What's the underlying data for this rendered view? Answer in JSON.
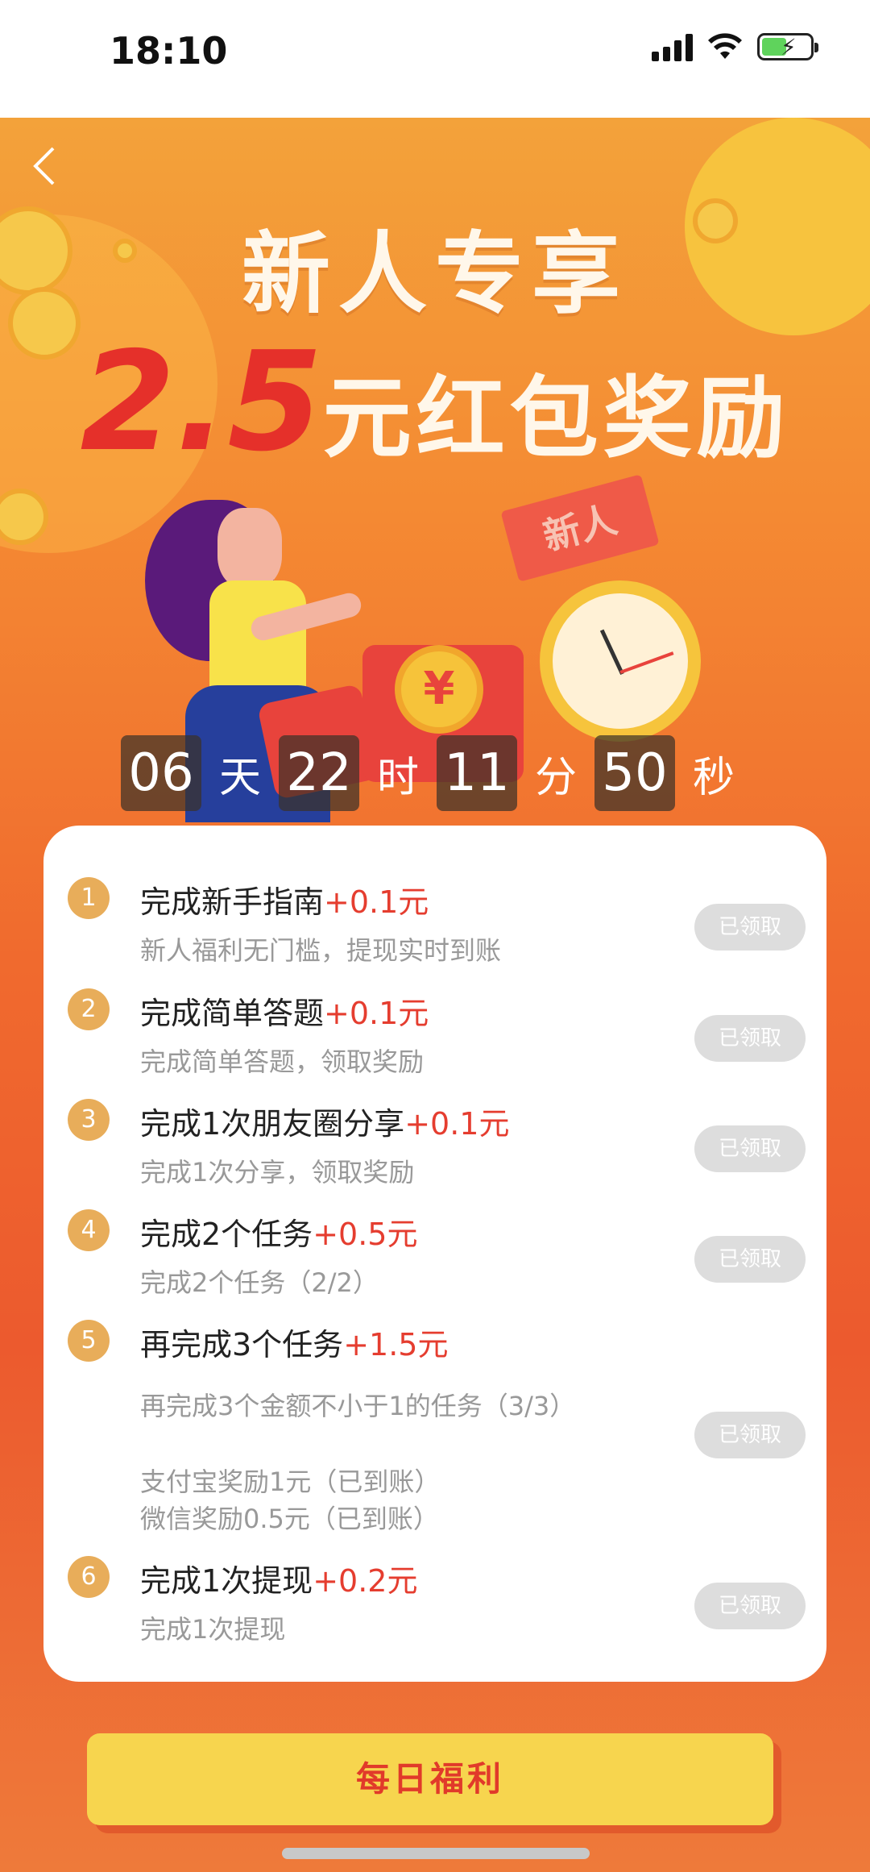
{
  "status_bar": {
    "time": "18:10"
  },
  "hero": {
    "title_line1": "新人专享",
    "amount": "2.5",
    "title_line2_rest": "元红包奖励",
    "ticket_text": "新人",
    "coin_symbol": "¥"
  },
  "countdown": {
    "days": "06",
    "days_unit": "天",
    "hours": "22",
    "hours_unit": "时",
    "minutes": "11",
    "minutes_unit": "分",
    "seconds": "50",
    "seconds_unit": "秒"
  },
  "tasks": [
    {
      "num": "1",
      "title": "完成新手指南",
      "reward": "+0.1元",
      "desc": "新人福利无门槛，提现实时到账",
      "button": "已领取"
    },
    {
      "num": "2",
      "title": "完成简单答题",
      "reward": "+0.1元",
      "desc": "完成简单答题，领取奖励",
      "button": "已领取"
    },
    {
      "num": "3",
      "title": "完成1次朋友圈分享",
      "reward": "+0.1元",
      "desc": "完成1次分享，领取奖励",
      "button": "已领取"
    },
    {
      "num": "4",
      "title": "完成2个任务",
      "reward": "+0.5元",
      "desc": "完成2个任务（2/2）",
      "button": "已领取"
    },
    {
      "num": "5",
      "title": "再完成3个任务",
      "reward": "+1.5元",
      "desc": "再完成3个金额不小于1的任务（3/3）",
      "desc2": "支付宝奖励1元（已到账）",
      "desc3": "微信奖励0.5元（已到账）",
      "button": "已领取"
    },
    {
      "num": "6",
      "title": "完成1次提现",
      "reward": "+0.2元",
      "desc": "完成1次提现",
      "button": "已领取"
    }
  ],
  "bottom_button": {
    "label": "每日福利"
  },
  "colors": {
    "accent_red": "#e53d2f",
    "button_yellow": "#f7d54e",
    "claimed_gray": "#dddddd"
  }
}
